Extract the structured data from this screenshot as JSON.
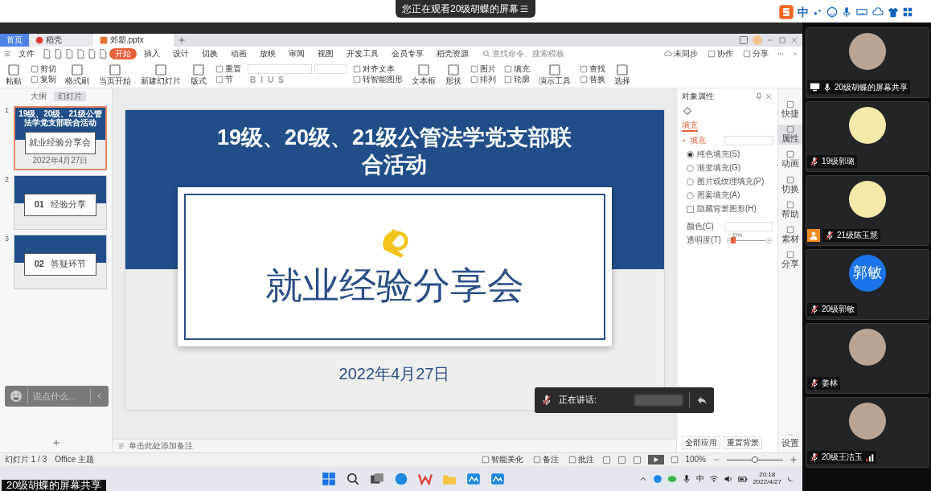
{
  "screen_share_banner": {
    "text": "您正在观看20级胡蝶的屏幕"
  },
  "ime_toolbar": {
    "mode": "中"
  },
  "app": {
    "tabs": [
      {
        "label": "首页",
        "kind": "home",
        "selected": false
      },
      {
        "label": "稻壳",
        "kind": "docer",
        "selected": false
      },
      {
        "label": "郊塑.pptx",
        "kind": "pptx",
        "selected": true
      }
    ],
    "file_menu": "文件",
    "ribbon_tabs": [
      {
        "label": "开始",
        "selected": true
      },
      {
        "label": "插入",
        "selected": false
      },
      {
        "label": "设计",
        "selected": false
      },
      {
        "label": "切换",
        "selected": false
      },
      {
        "label": "动画",
        "selected": false
      },
      {
        "label": "放映",
        "selected": false
      },
      {
        "label": "审阅",
        "selected": false
      },
      {
        "label": "视图",
        "selected": false
      },
      {
        "label": "开发工具",
        "selected": false
      },
      {
        "label": "会员专享",
        "selected": false
      },
      {
        "label": "稻壳资源",
        "selected": false
      }
    ],
    "command_search": {
      "placeholder": "查找命令、搜索模板"
    },
    "account_actions": [
      "未同步",
      "协作",
      "分享"
    ],
    "ribbon": [
      {
        "kind": "large",
        "label": "粘贴"
      },
      {
        "kind": "stack",
        "items": [
          "剪切",
          "复制"
        ]
      },
      {
        "kind": "large",
        "label": "格式刷"
      },
      {
        "kind": "large",
        "label": "当页开始"
      },
      {
        "kind": "large",
        "label": "新建幻灯片"
      },
      {
        "kind": "large",
        "label": "版式"
      },
      {
        "kind": "stack",
        "items": [
          "重置",
          "节"
        ]
      },
      {
        "kind": "font",
        "format_glyphs": [
          "B",
          "I",
          "U",
          "S"
        ]
      },
      {
        "kind": "stack",
        "items": [
          "对齐文本",
          "转智能图形"
        ]
      },
      {
        "kind": "large",
        "label": "文本框"
      },
      {
        "kind": "large",
        "label": "形状"
      },
      {
        "kind": "stack",
        "items": [
          "图片",
          "排列"
        ]
      },
      {
        "kind": "stack",
        "items": [
          "填充",
          "轮廓"
        ]
      },
      {
        "kind": "large",
        "label": "演示工具"
      },
      {
        "kind": "stack",
        "items": [
          "查找",
          "替换"
        ]
      },
      {
        "kind": "large",
        "label": "选择"
      }
    ],
    "view_tabs": [
      {
        "label": "大纲",
        "selected": false
      },
      {
        "label": "幻灯片",
        "selected": true
      }
    ],
    "slides": [
      {
        "number": "1",
        "kind": "title",
        "selected": true,
        "title": "19级、20级、21级公管法学党支部联合活动",
        "heading": "就业经验分享会",
        "date": "2022年4月27日"
      },
      {
        "number": "2",
        "kind": "section",
        "selected": false,
        "index": "01",
        "heading": "经验分享"
      },
      {
        "number": "3",
        "kind": "section",
        "selected": false,
        "index": "02",
        "heading": "答疑环节"
      }
    ],
    "current_slide": {
      "title": "19级、20级、21级公管法学党支部联合活动",
      "heading": "就业经验分享会",
      "date": "2022年4月27日"
    },
    "notes_placeholder": "单击此处添加备注",
    "properties": {
      "title": "对象属性",
      "tab": {
        "label": "填充",
        "selected": true
      },
      "section": "填充",
      "fill_options": [
        {
          "label": "纯色填充(S)",
          "selected": true
        },
        {
          "label": "渐变填充(G)",
          "selected": false
        },
        {
          "label": "图片或纹理填充(P)",
          "selected": false
        },
        {
          "label": "图案填充(A)",
          "selected": false
        }
      ],
      "hide_background": {
        "label": "隐藏背景图形(H)",
        "checked": false
      },
      "color_label": "颜色(C)",
      "transparency": {
        "label": "透明度(T)",
        "reading": "0%",
        "level": 0
      },
      "buttons": [
        "全部应用",
        "重置背景"
      ]
    },
    "side_strip": [
      {
        "label": "快捷",
        "selected": false
      },
      {
        "label": "属性",
        "selected": true
      },
      {
        "label": "动画",
        "selected": false
      },
      {
        "label": "切换",
        "selected": false
      },
      {
        "label": "帮助",
        "selected": false
      },
      {
        "label": "素材",
        "selected": false
      },
      {
        "label": "分享",
        "selected": false
      }
    ],
    "settings_label": "设置",
    "status_bar": {
      "slide_count": "幻灯片 1 / 3",
      "theme": "Office 主题",
      "beautify": "智能美化",
      "notes": "备注",
      "comments": "批注",
      "zoom": "100%",
      "zoom_slider": {
        "level": 0.5
      }
    }
  },
  "chat_input": {
    "placeholder": "说点什么..."
  },
  "speaking_indicator": {
    "label": "正在讲话:"
  },
  "taskbar": {
    "share_label": "20级胡蝶的屏幕共享",
    "ime": "中",
    "time": "20:18",
    "date": "2022/4/27"
  },
  "participants": [
    {
      "name": "20级胡蝶的屏幕共享",
      "muted": false,
      "sharing": true,
      "host_badge": false,
      "signal": false,
      "avatar": {
        "kind": "photo"
      }
    },
    {
      "name": "19级郭璐",
      "muted": true,
      "sharing": false,
      "host_badge": false,
      "signal": false,
      "avatar": {
        "kind": "illustration"
      }
    },
    {
      "name": "21级陈玉慧",
      "muted": true,
      "sharing": false,
      "host_badge": true,
      "signal": false,
      "avatar": {
        "kind": "illustration"
      }
    },
    {
      "name": "20级郭敏",
      "muted": true,
      "sharing": false,
      "host_badge": false,
      "signal": false,
      "avatar": {
        "kind": "initials",
        "text": "郭敏"
      }
    },
    {
      "name": "姜林",
      "muted": true,
      "sharing": false,
      "host_badge": false,
      "signal": false,
      "avatar": {
        "kind": "photo"
      }
    },
    {
      "name": "20级王洁玉",
      "muted": true,
      "sharing": false,
      "host_badge": false,
      "signal": true,
      "avatar": {
        "kind": "photo"
      }
    }
  ]
}
